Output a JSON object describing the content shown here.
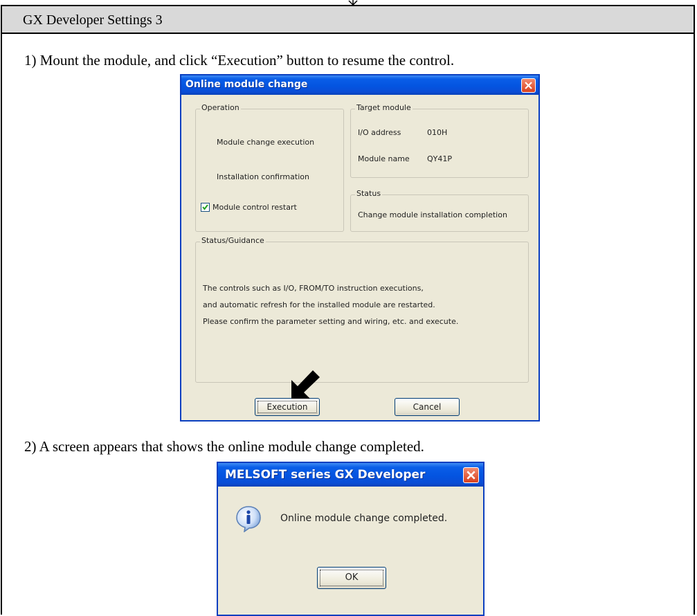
{
  "header": {
    "title": "GX Developer Settings 3"
  },
  "steps": [
    {
      "text": "1) Mount the module, and click “Execution” button to resume the control."
    },
    {
      "text": "2) A screen appears that shows the online module change completed."
    }
  ],
  "dialog1": {
    "title": "Online module change",
    "operation": {
      "legend": "Operation",
      "item1": "Module change execution",
      "item2": "Installation confirmation",
      "checkbox_label": "Module control restart",
      "checkbox_checked": true
    },
    "target": {
      "legend": "Target module",
      "io_label": "I/O address",
      "io_value": "010H",
      "name_label": "Module name",
      "name_value": "QY41P"
    },
    "status": {
      "legend": "Status",
      "text": "Change module installation completion"
    },
    "guidance": {
      "legend": "Status/Guidance",
      "line1": "The controls such as I/O, FROM/TO instruction executions,",
      "line2": "and automatic refresh for the installed module are restarted.",
      "line3": "Please confirm the parameter setting and wiring, etc. and execute."
    },
    "buttons": {
      "execution": "Execution",
      "cancel": "Cancel"
    }
  },
  "dialog2": {
    "title": "MELSOFT series GX Developer",
    "message": "Online module change completed.",
    "ok_button": "OK"
  },
  "colors": {
    "xp_title_blue": "#0454e0",
    "dialog_face": "#ece9d8",
    "header_gray": "#d9d9d9"
  }
}
